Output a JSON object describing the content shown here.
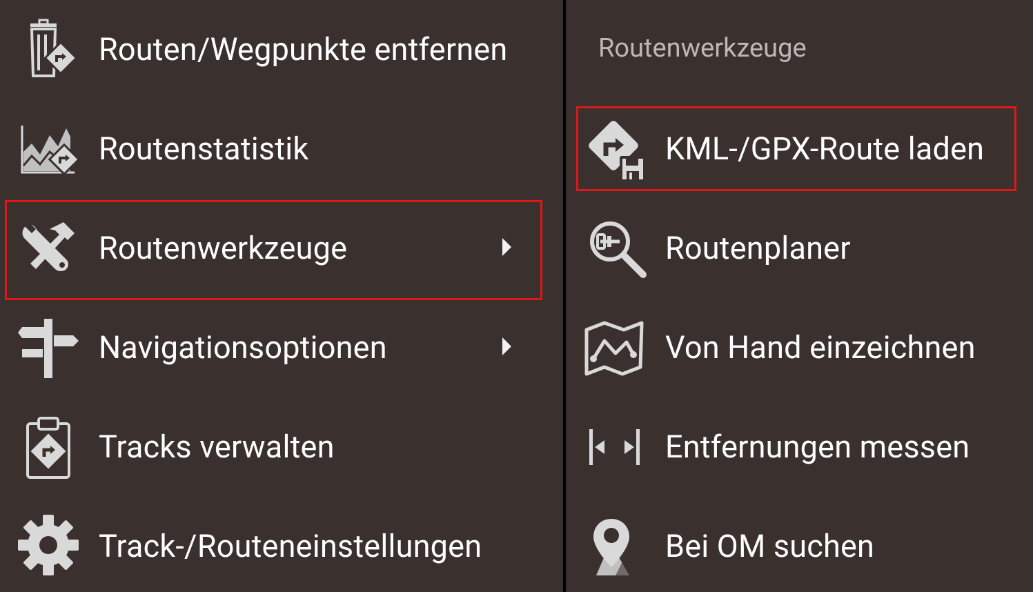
{
  "left_menu": {
    "items": [
      {
        "label": "Routen/Wegpunkte entfernen",
        "icon": "trash-route-icon",
        "has_submenu": false
      },
      {
        "label": "Routenstatistik",
        "icon": "route-statistics-icon",
        "has_submenu": false
      },
      {
        "label": "Routenwerkzeuge",
        "icon": "tools-icon",
        "has_submenu": true,
        "highlighted": true
      },
      {
        "label": "Navigationsoptionen",
        "icon": "signpost-icon",
        "has_submenu": true
      },
      {
        "label": "Tracks verwalten",
        "icon": "clipboard-route-icon",
        "has_submenu": false
      },
      {
        "label": "Track-/Routeneinstellungen",
        "icon": "gear-icon",
        "has_submenu": false
      }
    ]
  },
  "right_menu": {
    "header": "Routenwerkzeuge",
    "items": [
      {
        "label": "KML-/GPX-Route laden",
        "icon": "route-load-icon",
        "highlighted": true
      },
      {
        "label": "Routenplaner",
        "icon": "route-planner-search-icon"
      },
      {
        "label": "Von Hand einzeichnen",
        "icon": "map-draw-icon"
      },
      {
        "label": "Entfernungen messen",
        "icon": "measure-distance-icon"
      },
      {
        "label": "Bei OM suchen",
        "icon": "om-search-pin-icon"
      }
    ]
  },
  "colors": {
    "background": "#3a312f",
    "divider": "#000000",
    "text": "#ffffff",
    "header_text": "#bdb8b5",
    "icon": "#d9d9d9",
    "highlight": "#e01717"
  }
}
